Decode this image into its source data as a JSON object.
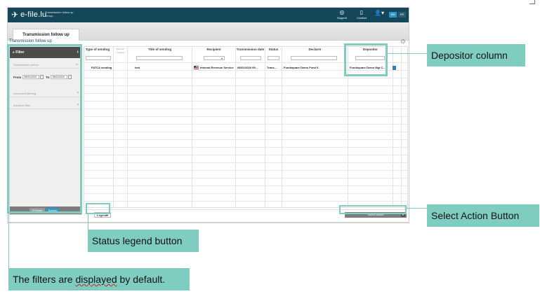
{
  "app": {
    "logo_text": "e-file.lu",
    "logo_subtitle": "Transmission follow up Group -",
    "support_label": "Support",
    "contact_label": "Contact",
    "lang_en": "EN",
    "lang_fr": "FR",
    "tab_label": "Transmission follow up",
    "section_title": "Transmission follow up",
    "help": "?"
  },
  "filter": {
    "title": "Filter",
    "transmission_period": "Transmission period",
    "from_label": "From",
    "from_value": "08/01/2020",
    "to_label": "To",
    "to_value": "08/01/2020",
    "document_filtering": "Document filtering",
    "advance_filter": "Advance filter",
    "reset_label": "Reset",
    "search_label": "Search"
  },
  "grid": {
    "headers": {
      "type": "Type of sending",
      "expand": "Expand/ Collapse",
      "title": "Title of sending",
      "recipient": "Recipient",
      "date": "Transmission date",
      "status": "Status",
      "declarer": "Declarer",
      "depositor": "Depositor"
    },
    "row": {
      "type": "FATCA sending",
      "title": "test",
      "recipient": "Internal Revenue Service",
      "date": "08/01/2020 09...",
      "status": "Trans...",
      "declarer": "Fundsquare Demo Fund 6",
      "depositor": "Fundsquare Demo Mgt C..."
    }
  },
  "bottom": {
    "legend_label": "Legend",
    "select_action_label": "Select Action"
  },
  "annotations": {
    "depositor": "Depositor column",
    "select_action": "Select Action Button",
    "legend": "Status legend button",
    "filters_before": "The filters are",
    "filters_word": "displayed",
    "filters_after": "by default."
  },
  "colors": {
    "topbar": "#15475a",
    "accent": "#2f97c7",
    "annotation": "#7fcdc1"
  }
}
